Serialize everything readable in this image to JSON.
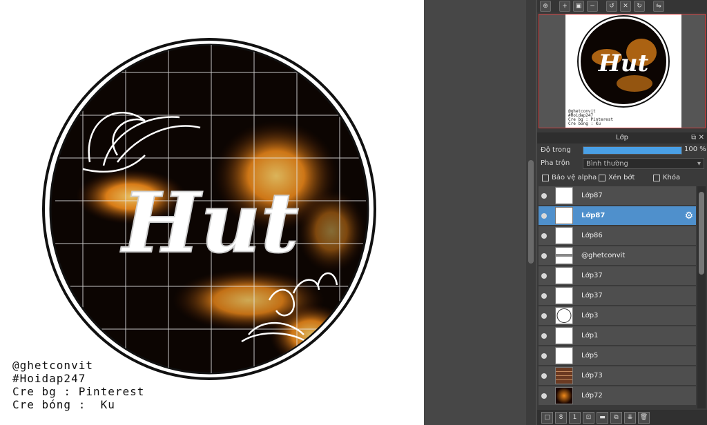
{
  "canvas": {
    "artwork_text": "Hut",
    "credits": [
      "@ghetconvit",
      "#Hoidap247",
      "Cre bg : Pinterest",
      "Cre bóng :  Ku"
    ]
  },
  "navigator": {
    "toolbar_icons": [
      "zoom-fit-icon",
      "zoom-in-icon",
      "fit-screen-icon",
      "zoom-out-icon",
      "rotate-left-icon",
      "reset-rotation-icon",
      "rotate-right-icon",
      "flip-icon"
    ]
  },
  "layers_panel": {
    "title": "Lớp",
    "opacity_label": "Độ trong",
    "opacity_value": "100 %",
    "opacity_fraction": 1.0,
    "blend_label": "Pha trộn",
    "blend_value": "Bình thường",
    "protect_alpha_label": "Bảo vệ alpha",
    "clipping_label": "Xén bớt",
    "lock_label": "Khóa",
    "layers": [
      {
        "name": "Lớp87",
        "thumb": "blank"
      },
      {
        "name": "Lớp87",
        "thumb": "blank",
        "selected": true
      },
      {
        "name": "Lớp86",
        "thumb": "blank"
      },
      {
        "name": "@ghetconvit",
        "thumb": "text"
      },
      {
        "name": "Lớp37",
        "thumb": "blank"
      },
      {
        "name": "Lớp37",
        "thumb": "blank"
      },
      {
        "name": "Lớp3",
        "thumb": "circle"
      },
      {
        "name": "Lớp1",
        "thumb": "white"
      },
      {
        "name": "Lớp5",
        "thumb": "blank"
      },
      {
        "name": "Lớp73",
        "thumb": "grid"
      },
      {
        "name": "Lớp72",
        "thumb": "fire"
      }
    ]
  },
  "colors": {
    "accent": "#4f90cc",
    "fire": "#f08a1a",
    "panel": "#3a3a3a"
  }
}
